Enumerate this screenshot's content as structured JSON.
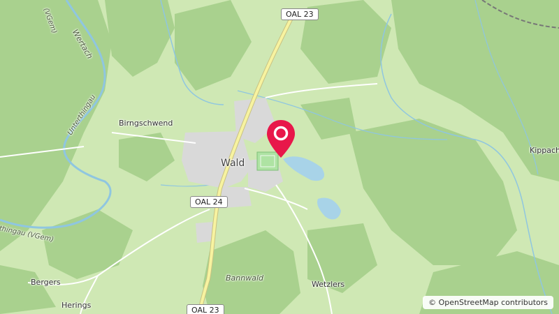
{
  "map": {
    "attribution": "© OpenStreetMap contributors",
    "colors": {
      "meadow": "#cfe8b4",
      "forest": "#a9d18e",
      "water": "#a8d3e8",
      "road_fill": "#f7f3a0",
      "road_casing": "#c9c281",
      "settlement": "#d9d9d9",
      "marker": "#e8174a"
    },
    "places": {
      "wald": "Wald",
      "birngschwend": "Birngschwend",
      "wetzlers": "Wetzlers",
      "bergers": "Bergers",
      "herings": "Herings",
      "kippachm": "Kippachm",
      "bannwald": "Bannwald"
    },
    "waterways": {
      "wertach": "Wertach",
      "unterthingau": "Unterthingau",
      "thingau_vgem": "thingau (VGem)",
      "vgem_top": "(VGem)"
    },
    "roads": {
      "oal23_top": "OAL 23",
      "oal24": "OAL 24",
      "oal23_bottom": "OAL 23"
    },
    "marker_icon": "map-pin-icon"
  }
}
